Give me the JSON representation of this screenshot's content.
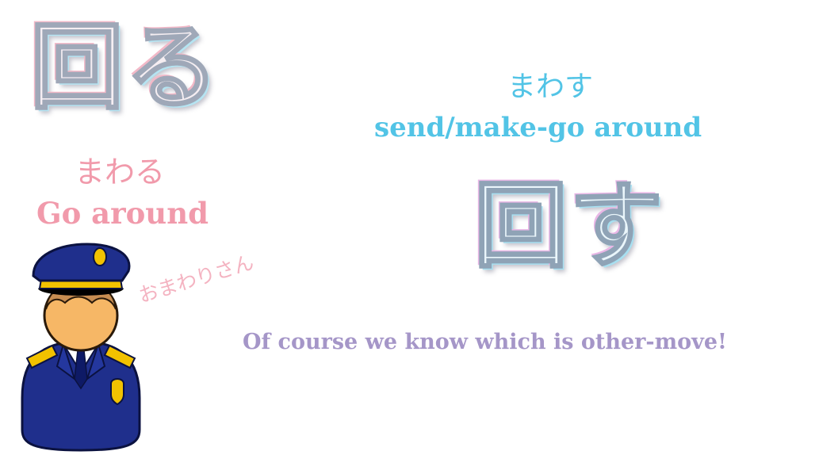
{
  "left_word": {
    "kanji": "回る",
    "reading": "まわる",
    "meaning": "Go around"
  },
  "right_word": {
    "kanji": "回す",
    "reading": "まわす",
    "meaning": "send/make-go around"
  },
  "side_label": "おまわりさん",
  "footer_note": "Of course we know which is other-move!",
  "colors": {
    "pink": "#f19aab",
    "blue": "#52c4e6",
    "purple": "#a596c8",
    "uniform_navy": "#1f2f8c",
    "badge_gold": "#f2c200"
  },
  "icons": {
    "officer": "police-officer-icon"
  }
}
